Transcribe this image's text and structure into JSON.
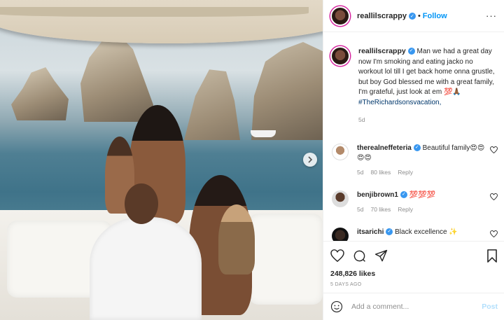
{
  "post": {
    "next_icon": "chevron-right-icon"
  },
  "header": {
    "username": "reallilscrappy",
    "dot": "•",
    "follow_label": "Follow",
    "more_label": "···"
  },
  "caption": {
    "username": "reallilscrappy",
    "text": "Man we had a great day now I'm smoking and eating jacko no workout lol till I get back home onna grustle, but boy God blessed me with a great family, I'm grateful, just look at em 💯🙏🏾",
    "hashtag": "#TheRichardsonsvacation,",
    "time": "5d"
  },
  "comments": [
    {
      "username": "therealneffeteria",
      "text": "Beautiful family😍😍😍😍",
      "time": "5d",
      "likes": "80 likes",
      "reply": "Reply"
    },
    {
      "username": "benjibrown1",
      "text": "💯💯💯",
      "time": "5d",
      "likes": "70 likes",
      "reply": "Reply"
    },
    {
      "username": "itsarichi",
      "text": "Black excellence ✨",
      "time": "",
      "likes": "",
      "reply": ""
    }
  ],
  "actions": {
    "likes": "248,826 likes",
    "time_ago": "5 DAYS AGO"
  },
  "add_comment": {
    "placeholder": "Add a comment...",
    "post_label": "Post"
  },
  "colors": {
    "accent": "#0095f6",
    "verified": "#3897f0",
    "muted": "#8e8e8e",
    "post_disabled": "#b2dffc"
  }
}
